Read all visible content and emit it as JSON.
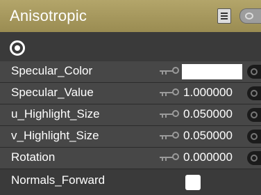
{
  "panel": {
    "title": "Anisotropic"
  },
  "properties": [
    {
      "label": "Specular_Color",
      "type": "color",
      "value": "#ffffff"
    },
    {
      "label": "Specular_Value",
      "type": "number",
      "value": "1.000000"
    },
    {
      "label": "u_Highlight_Size",
      "type": "number",
      "value": "0.050000"
    },
    {
      "label": "v_Highlight_Size",
      "type": "number",
      "value": "0.050000"
    },
    {
      "label": "Rotation",
      "type": "number",
      "value": "0.000000"
    },
    {
      "label": "Normals_Forward",
      "type": "checkbox",
      "value": "unchecked"
    }
  ],
  "colors": {
    "header": "#a89a5e",
    "panel_bg": "#3b3b3b",
    "row_alt": "#474747",
    "text": "#ffffff"
  },
  "icons": [
    "document-icon",
    "eye-icon",
    "target-icon",
    "link-icon",
    "node-connect-icon"
  ]
}
